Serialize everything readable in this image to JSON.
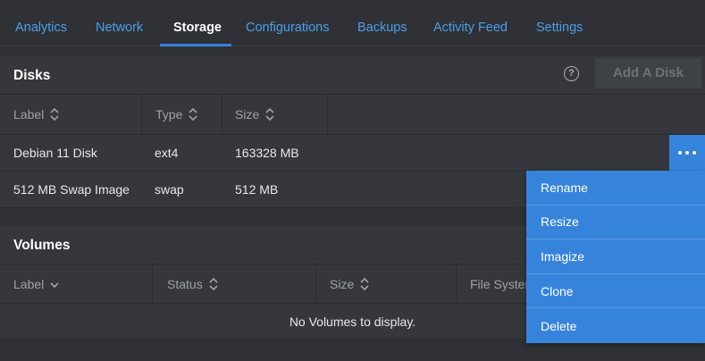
{
  "tabs": [
    {
      "label": "Analytics"
    },
    {
      "label": "Network"
    },
    {
      "label": "Storage"
    },
    {
      "label": "Configurations"
    },
    {
      "label": "Backups"
    },
    {
      "label": "Activity Feed"
    },
    {
      "label": "Settings"
    }
  ],
  "active_tab": "Storage",
  "disks": {
    "title": "Disks",
    "help_icon": "?",
    "add_button": "Add A Disk",
    "columns": [
      "Label",
      "Type",
      "Size"
    ],
    "rows": [
      {
        "label": "Debian 11 Disk",
        "type": "ext4",
        "size": "163328 MB"
      },
      {
        "label": "512 MB Swap Image",
        "type": "swap",
        "size": "512 MB"
      }
    ]
  },
  "volumes": {
    "title": "Volumes",
    "columns": [
      "Label",
      "Status",
      "Size",
      "File System"
    ],
    "empty": "No Volumes to display."
  },
  "action_menu": {
    "items": [
      "Rename",
      "Resize",
      "Imagize",
      "Clone",
      "Delete"
    ]
  },
  "colors": {
    "accent": "#3683dc",
    "tab_link": "#4c9fe6",
    "background": "#2f3136",
    "panel": "#35373c"
  },
  "icons": {
    "sort": "sort-updown-icon",
    "sort_desc": "sort-down-icon",
    "more": "more-horizontal-icon",
    "help": "help-circle-icon"
  }
}
